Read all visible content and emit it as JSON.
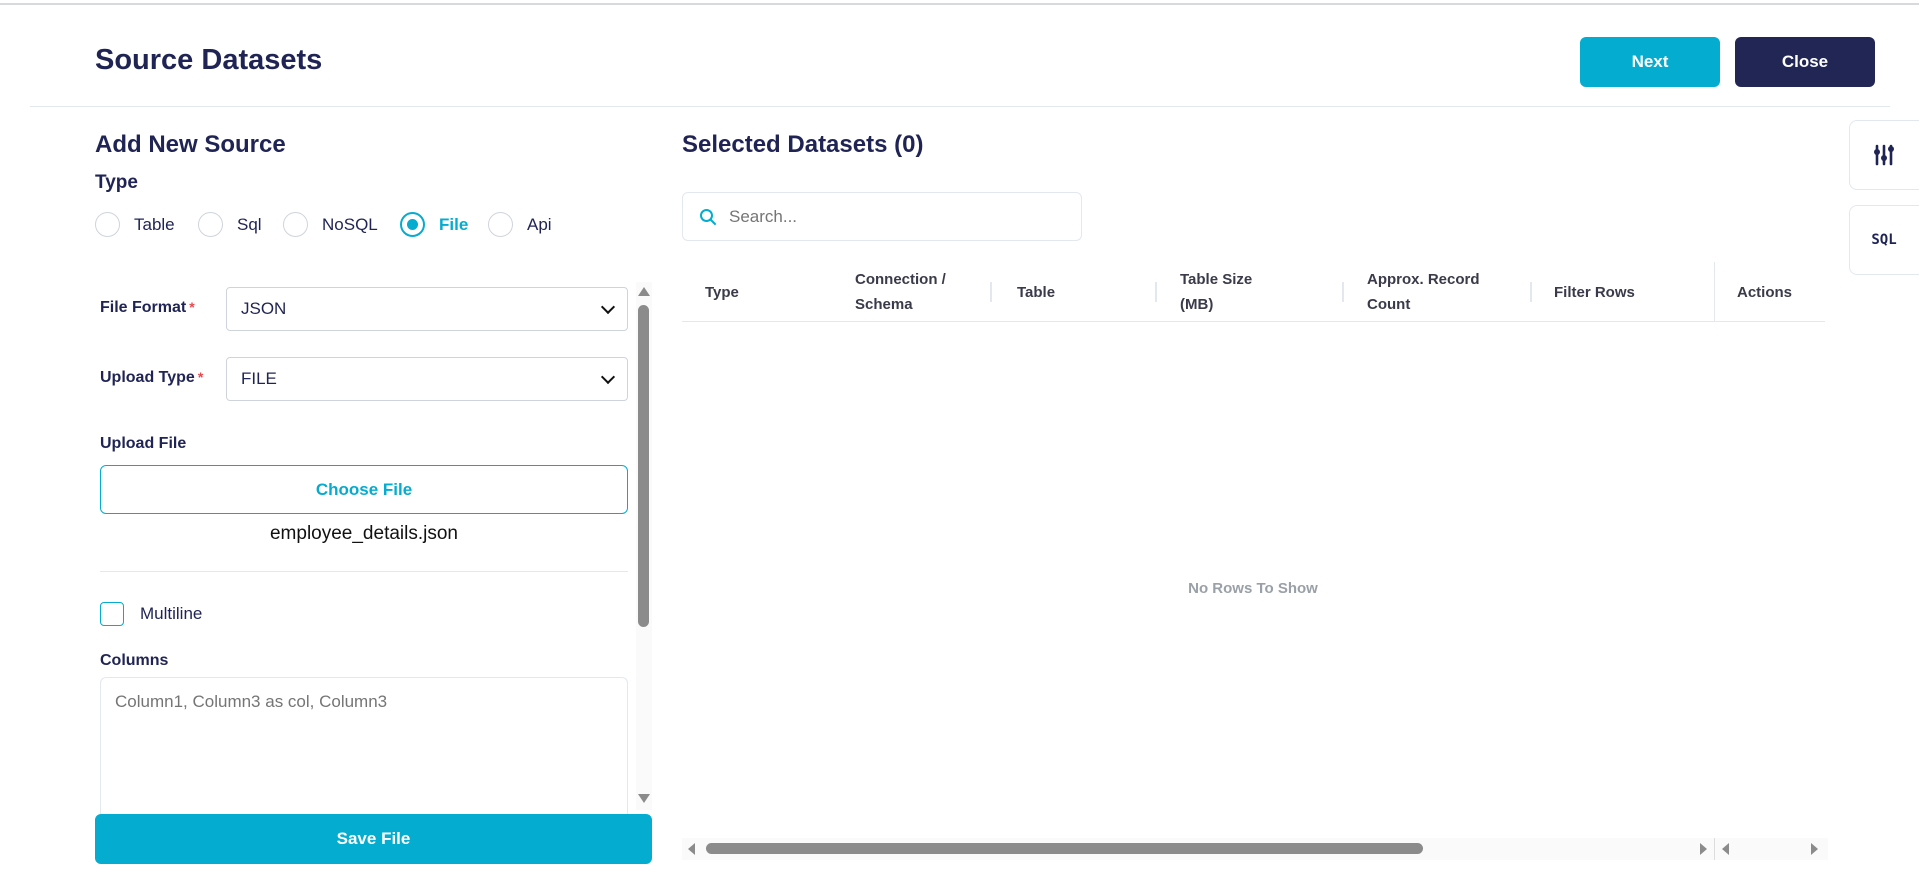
{
  "header": {
    "title": "Source Datasets",
    "next_label": "Next",
    "close_label": "Close"
  },
  "side_tools": {
    "sql_label": "SQL"
  },
  "form": {
    "title": "Add New Source",
    "type_label": "Type",
    "types": [
      {
        "label": "Table",
        "selected": false
      },
      {
        "label": "Sql",
        "selected": false
      },
      {
        "label": "NoSQL",
        "selected": false
      },
      {
        "label": "File",
        "selected": true
      },
      {
        "label": "Api",
        "selected": false
      }
    ],
    "file_format_label": "File Format",
    "file_format_value": "JSON",
    "upload_type_label": "Upload Type",
    "upload_type_value": "FILE",
    "required_mark": "*",
    "upload_file_label": "Upload File",
    "choose_file_label": "Choose File",
    "file_name": "employee_details.json",
    "multiline_label": "Multiline",
    "multiline_checked": false,
    "columns_label": "Columns",
    "columns_placeholder": "Column1, Column3 as col, Column3",
    "save_label": "Save File"
  },
  "datasets": {
    "title": "Selected Datasets (0)",
    "search_placeholder": "Search...",
    "columns": [
      "Type",
      "Connection / Schema",
      "Table",
      "Table Size (MB)",
      "Approx. Record Count",
      "Filter Rows",
      "Actions"
    ],
    "empty_message": "No Rows To Show"
  },
  "colors": {
    "primary": "#04acd0",
    "navy": "#212654"
  }
}
